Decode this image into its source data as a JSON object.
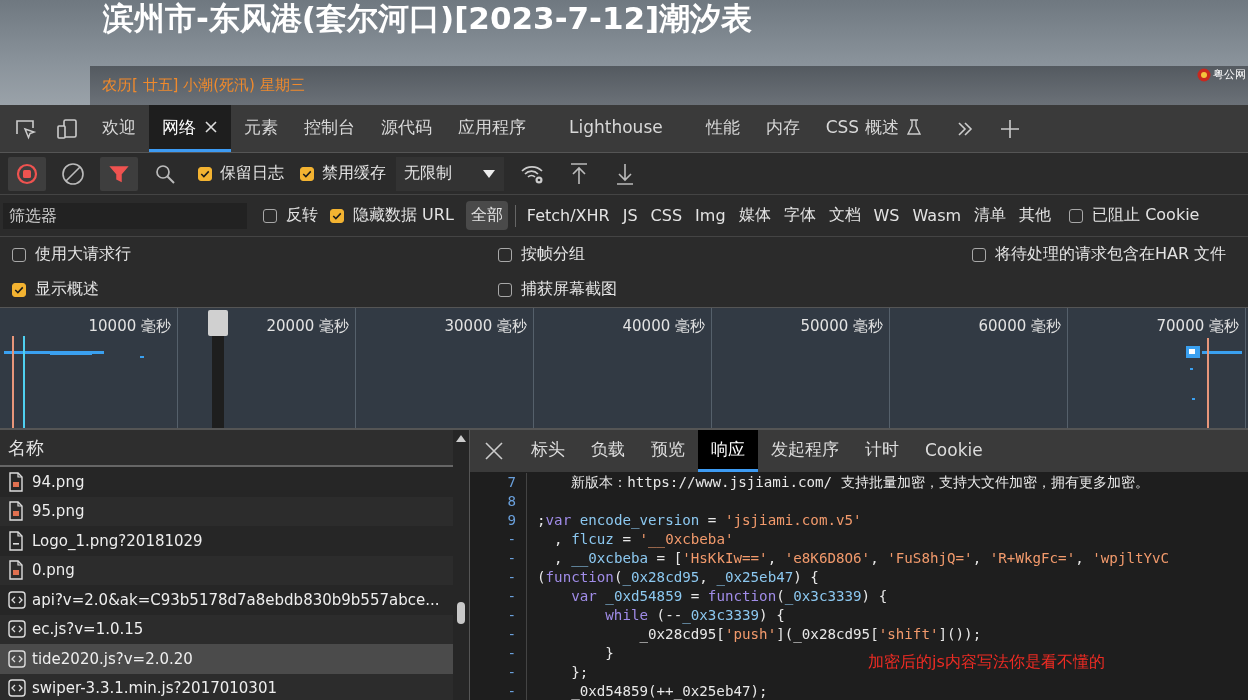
{
  "page": {
    "title": "滨州市-东风港(套尔河口)[2023-7-12]潮汐表",
    "subtitle": "农历[ 廿五] 小潮(死汛) 星期三",
    "badge": "粤公网"
  },
  "devtools_tabs": [
    {
      "label": "欢迎",
      "selected": false,
      "closable": false
    },
    {
      "label": "网络",
      "selected": true,
      "closable": true
    },
    {
      "label": "元素",
      "selected": false,
      "closable": false
    },
    {
      "label": "控制台",
      "selected": false,
      "closable": false
    },
    {
      "label": "源代码",
      "selected": false,
      "closable": false
    },
    {
      "label": "应用程序",
      "selected": false,
      "closable": false
    },
    {
      "label": "Lighthouse",
      "selected": false,
      "closable": false
    },
    {
      "label": "性能",
      "selected": false,
      "closable": false
    },
    {
      "label": "内存",
      "selected": false,
      "closable": false
    },
    {
      "label": "CSS 概述",
      "selected": false,
      "closable": false,
      "experimental": true
    }
  ],
  "toolbar": {
    "recording": true,
    "filter_on": true,
    "checkboxes": [
      {
        "label": "保留日志",
        "checked": true
      },
      {
        "label": "禁用缓存",
        "checked": true
      }
    ],
    "throttling": "无限制"
  },
  "filter_bar": {
    "placeholder": "筛选器",
    "checkboxes": [
      {
        "label": "反转",
        "checked": false
      },
      {
        "label": "隐藏数据 URL",
        "checked": true
      }
    ],
    "types": [
      {
        "label": "全部",
        "selected": true
      },
      {
        "label": "Fetch/XHR",
        "selected": false
      },
      {
        "label": "JS",
        "selected": false
      },
      {
        "label": "CSS",
        "selected": false
      },
      {
        "label": "Img",
        "selected": false
      },
      {
        "label": "媒体",
        "selected": false
      },
      {
        "label": "字体",
        "selected": false
      },
      {
        "label": "文档",
        "selected": false
      },
      {
        "label": "WS",
        "selected": false
      },
      {
        "label": "Wasm",
        "selected": false
      },
      {
        "label": "清单",
        "selected": false
      },
      {
        "label": "其他",
        "selected": false
      }
    ],
    "blocked_cookies": {
      "label": "已阻止 Cookie",
      "checked": false
    }
  },
  "options": [
    {
      "label": "使用大请求行",
      "checked": false
    },
    {
      "label": "按帧分组",
      "checked": false
    },
    {
      "label": "将待处理的请求包含在HAR 文件",
      "checked": false
    },
    {
      "label": "显示概述",
      "checked": true
    },
    {
      "label": "捕获屏幕截图",
      "checked": false
    }
  ],
  "timeline": {
    "ticks": [
      "10000 毫秒",
      "20000 毫秒",
      "30000 毫秒",
      "40000 毫秒",
      "50000 毫秒",
      "60000 毫秒",
      "70000 毫秒"
    ]
  },
  "request_list": {
    "column": "名称",
    "rows": [
      {
        "name": "94.png",
        "kind": "image",
        "selected": false
      },
      {
        "name": "95.png",
        "kind": "image",
        "selected": false
      },
      {
        "name": "Logo_1.png?20181029",
        "kind": "document",
        "selected": false
      },
      {
        "name": "0.png",
        "kind": "image",
        "selected": false
      },
      {
        "name": "api?v=2.0&ak=C93b5178d7a8ebdb830b9b557abce...",
        "kind": "script",
        "selected": false
      },
      {
        "name": "ec.js?v=1.0.15",
        "kind": "script",
        "selected": false
      },
      {
        "name": "tide2020.js?v=2.0.20",
        "kind": "script",
        "selected": true
      },
      {
        "name": "swiper-3.3.1.min.js?2017010301",
        "kind": "script",
        "selected": false
      }
    ]
  },
  "detail_tabs": [
    {
      "label": "标头",
      "selected": false
    },
    {
      "label": "负载",
      "selected": false
    },
    {
      "label": "预览",
      "selected": false
    },
    {
      "label": "响应",
      "selected": true
    },
    {
      "label": "发起程序",
      "selected": false
    },
    {
      "label": "计时",
      "selected": false
    },
    {
      "label": "Cookie",
      "selected": false
    }
  ],
  "code": [
    {
      "line": "7",
      "tokens": [
        {
          "kind": "plain",
          "text": "    新版本：https://www.jsjiami.com/ 支持批量加密，支持大文件加密，拥有更多加密。"
        }
      ]
    },
    {
      "line": "8"
    },
    {
      "line": "9",
      "tokens": [
        {
          "kind": "plain",
          "text": ";"
        },
        {
          "kind": "keyword",
          "text": "var"
        },
        {
          "kind": "name",
          "text": " encode_version"
        },
        {
          "kind": "plain",
          "text": " = "
        },
        {
          "kind": "string",
          "text": "'jsjiami.com.v5'"
        }
      ]
    },
    {
      "line": "-",
      "tokens": [
        {
          "kind": "plain",
          "text": "  , "
        },
        {
          "kind": "name",
          "text": "flcuz"
        },
        {
          "kind": "plain",
          "text": " = "
        },
        {
          "kind": "string",
          "text": "'__0xcbeba'"
        }
      ]
    },
    {
      "line": "-",
      "tokens": [
        {
          "kind": "plain",
          "text": "  , "
        },
        {
          "kind": "name",
          "text": "__0xcbeba"
        },
        {
          "kind": "plain",
          "text": " = ["
        },
        {
          "kind": "string",
          "text": "'HsKkIw=='"
        },
        {
          "kind": "plain",
          "text": ", "
        },
        {
          "kind": "string",
          "text": "'e8K6D8O6'"
        },
        {
          "kind": "plain",
          "text": ", "
        },
        {
          "kind": "string",
          "text": "'FuS8hjQ='"
        },
        {
          "kind": "plain",
          "text": ", "
        },
        {
          "kind": "string",
          "text": "'R+WkgFc='"
        },
        {
          "kind": "plain",
          "text": ", "
        },
        {
          "kind": "string",
          "text": "'wpjltYvC"
        }
      ]
    },
    {
      "line": "-",
      "tokens": [
        {
          "kind": "plain",
          "text": "("
        },
        {
          "kind": "keyword",
          "text": "function"
        },
        {
          "kind": "plain",
          "text": "("
        },
        {
          "kind": "name",
          "text": "_0x28cd95"
        },
        {
          "kind": "plain",
          "text": ", "
        },
        {
          "kind": "name",
          "text": "_0x25eb47"
        },
        {
          "kind": "plain",
          "text": ") {"
        }
      ]
    },
    {
      "line": "-",
      "tokens": [
        {
          "kind": "keyword",
          "text": "    var"
        },
        {
          "kind": "name",
          "text": " _0xd54859"
        },
        {
          "kind": "plain",
          "text": " = "
        },
        {
          "kind": "keyword",
          "text": "function"
        },
        {
          "kind": "plain",
          "text": "("
        },
        {
          "kind": "name",
          "text": "_0x3c3339"
        },
        {
          "kind": "plain",
          "text": ") {"
        }
      ]
    },
    {
      "line": "-",
      "tokens": [
        {
          "kind": "keyword",
          "text": "        while"
        },
        {
          "kind": "plain",
          "text": " (--"
        },
        {
          "kind": "name",
          "text": "_0x3c3339"
        },
        {
          "kind": "plain",
          "text": ") {"
        }
      ]
    },
    {
      "line": "-",
      "tokens": [
        {
          "kind": "plain",
          "text": "            _0x28cd95["
        },
        {
          "kind": "string",
          "text": "'push'"
        },
        {
          "kind": "plain",
          "text": "](_0x28cd95["
        },
        {
          "kind": "string",
          "text": "'shift'"
        },
        {
          "kind": "plain",
          "text": "]());"
        }
      ]
    },
    {
      "line": "-",
      "tokens": [
        {
          "kind": "plain",
          "text": "        }"
        }
      ]
    },
    {
      "line": "-",
      "tokens": [
        {
          "kind": "plain",
          "text": "    };"
        }
      ]
    },
    {
      "line": "-",
      "tokens": [
        {
          "kind": "plain",
          "text": "    _0xd54859(++_0x25eb47);"
        }
      ]
    }
  ],
  "annotation": "加密后的js内容写法你是看不懂的"
}
